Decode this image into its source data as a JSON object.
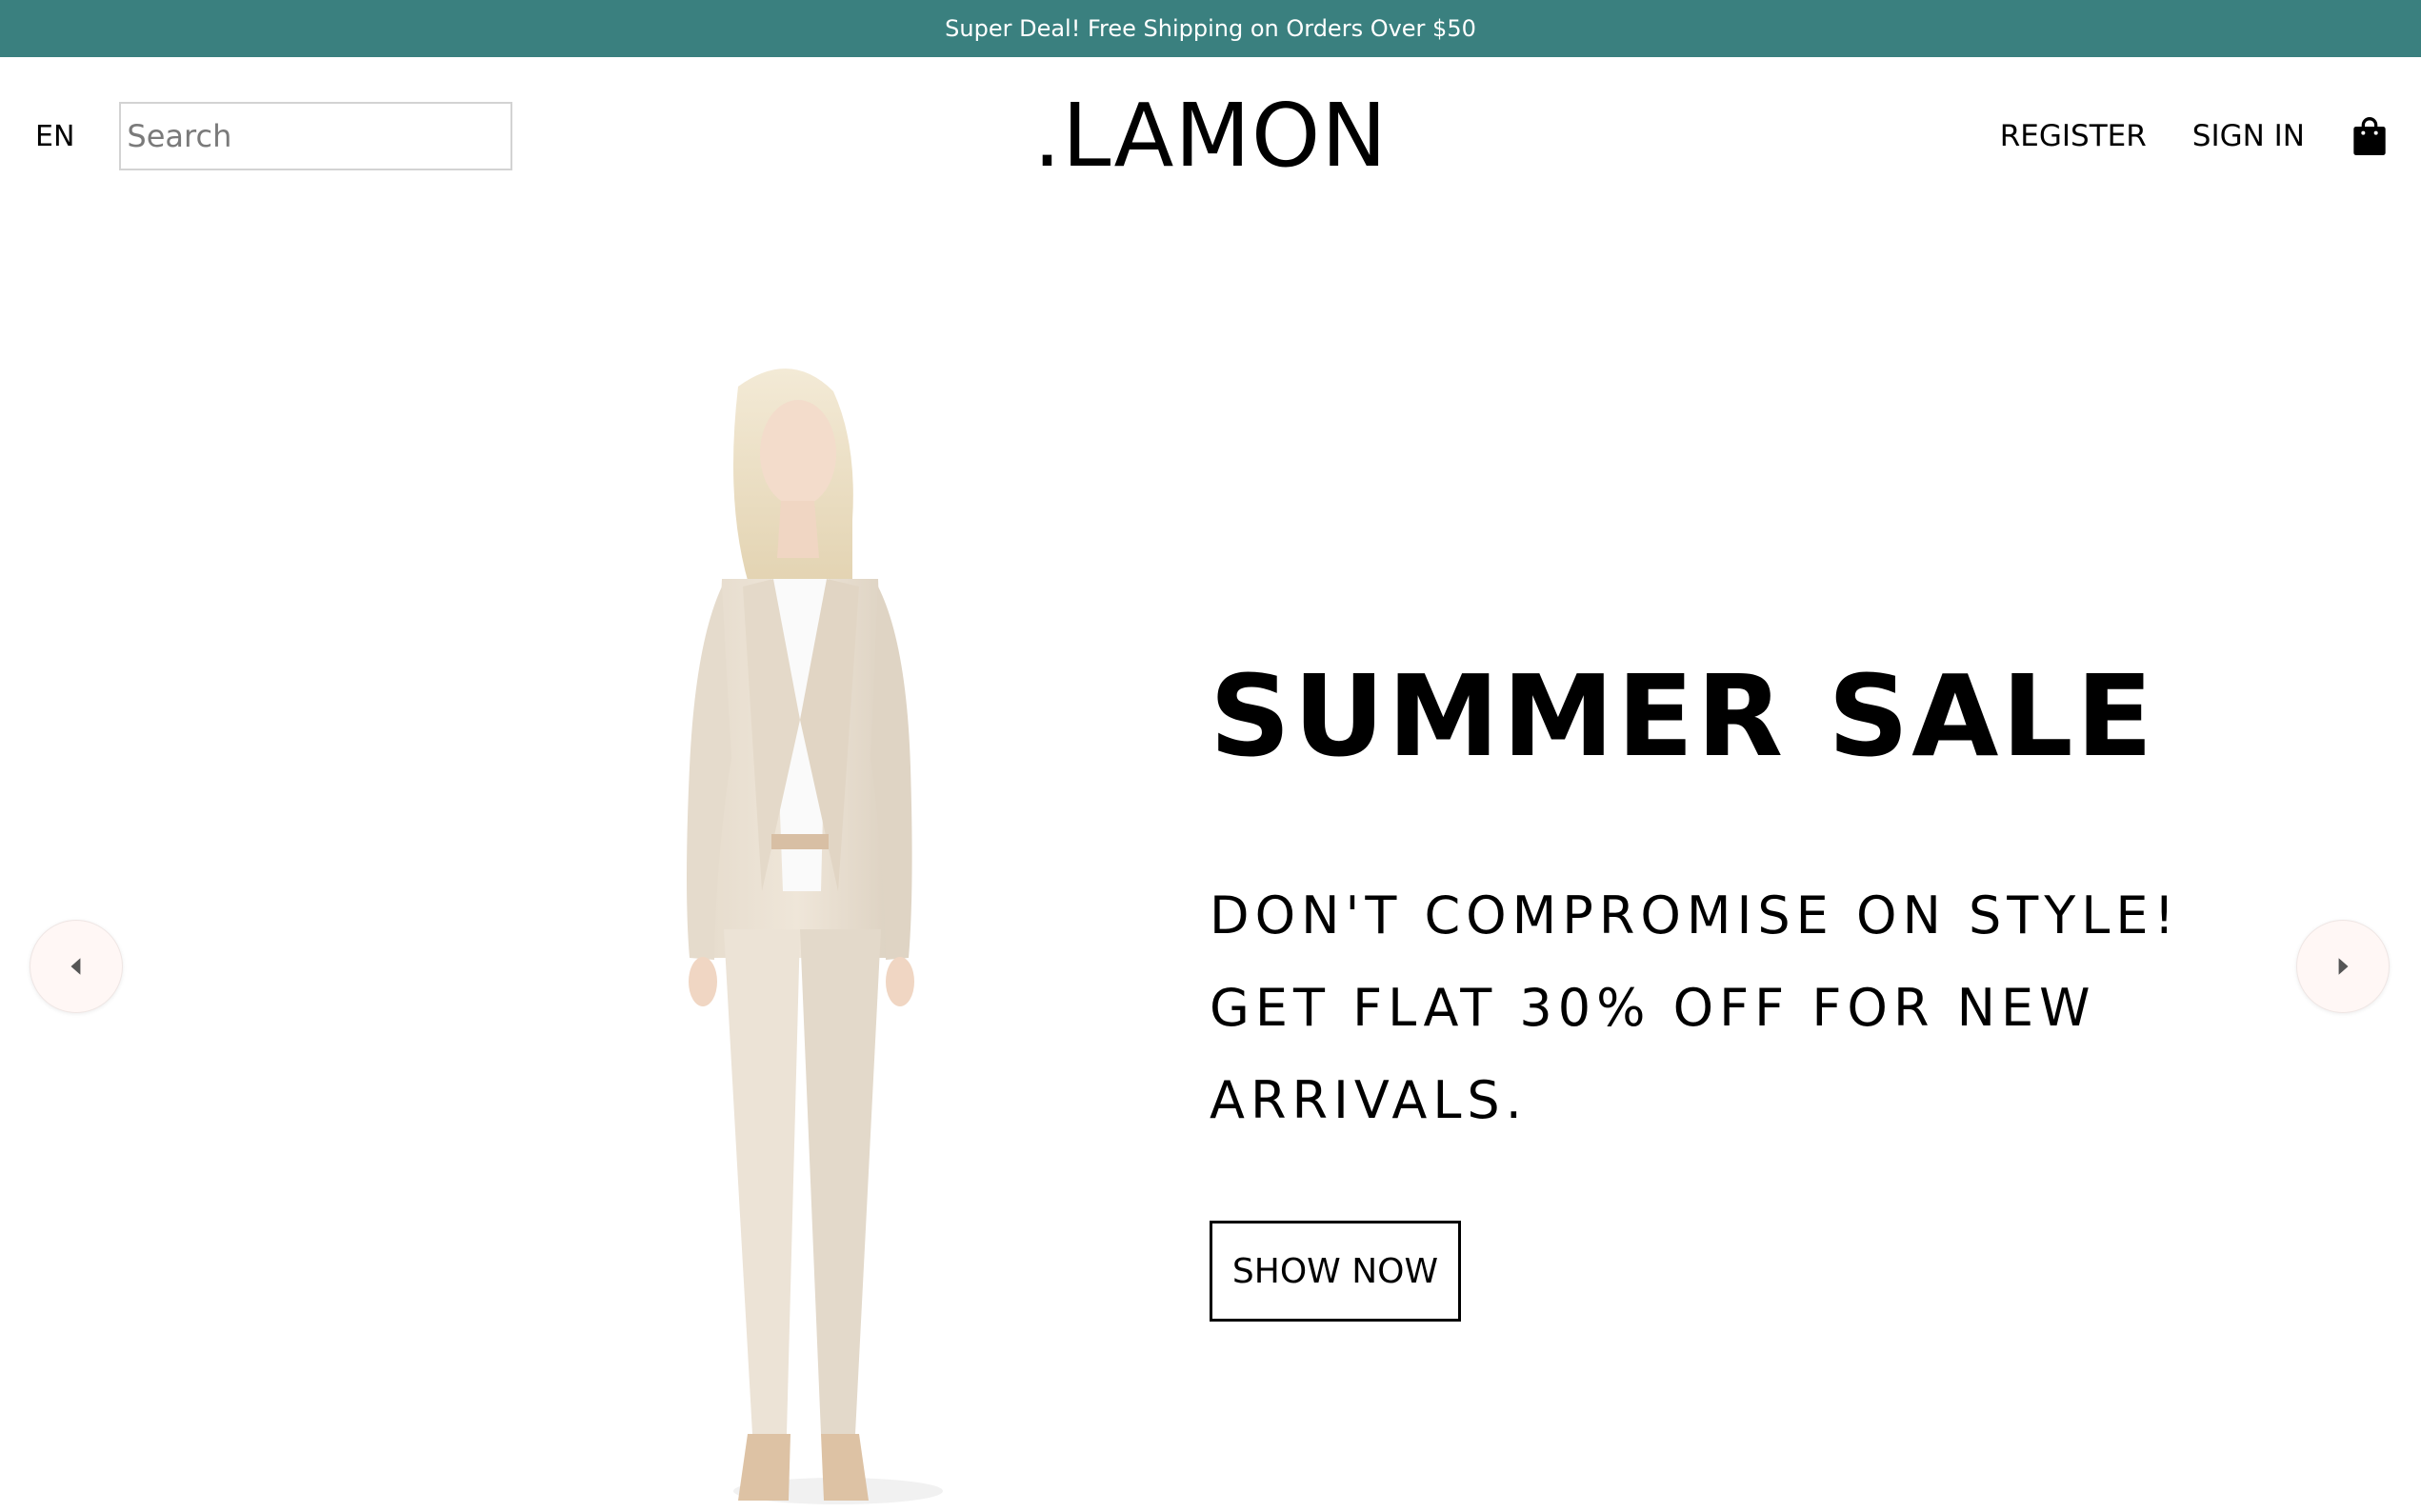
{
  "announcement": {
    "text": "Super Deal! Free Shipping on Orders Over $50",
    "background": "#3a807f"
  },
  "navbar": {
    "language": "EN",
    "search": {
      "placeholder": "Search",
      "value": "",
      "icon": "search-icon"
    },
    "logo": ".LAMON",
    "links": {
      "register": "REGISTER",
      "sign_in": "SIGN IN"
    },
    "cart_icon": "shopping-bag-icon"
  },
  "hero": {
    "title": "SUMMER SALE",
    "description": "DON'T COMPROMISE ON STYLE! GET FLAT 30% OFF FOR NEW ARRIVALS.",
    "button_label": "SHOW NOW",
    "prev_icon": "caret-left-icon",
    "next_icon": "caret-right-icon",
    "arrow_background": "#fff7f5"
  }
}
